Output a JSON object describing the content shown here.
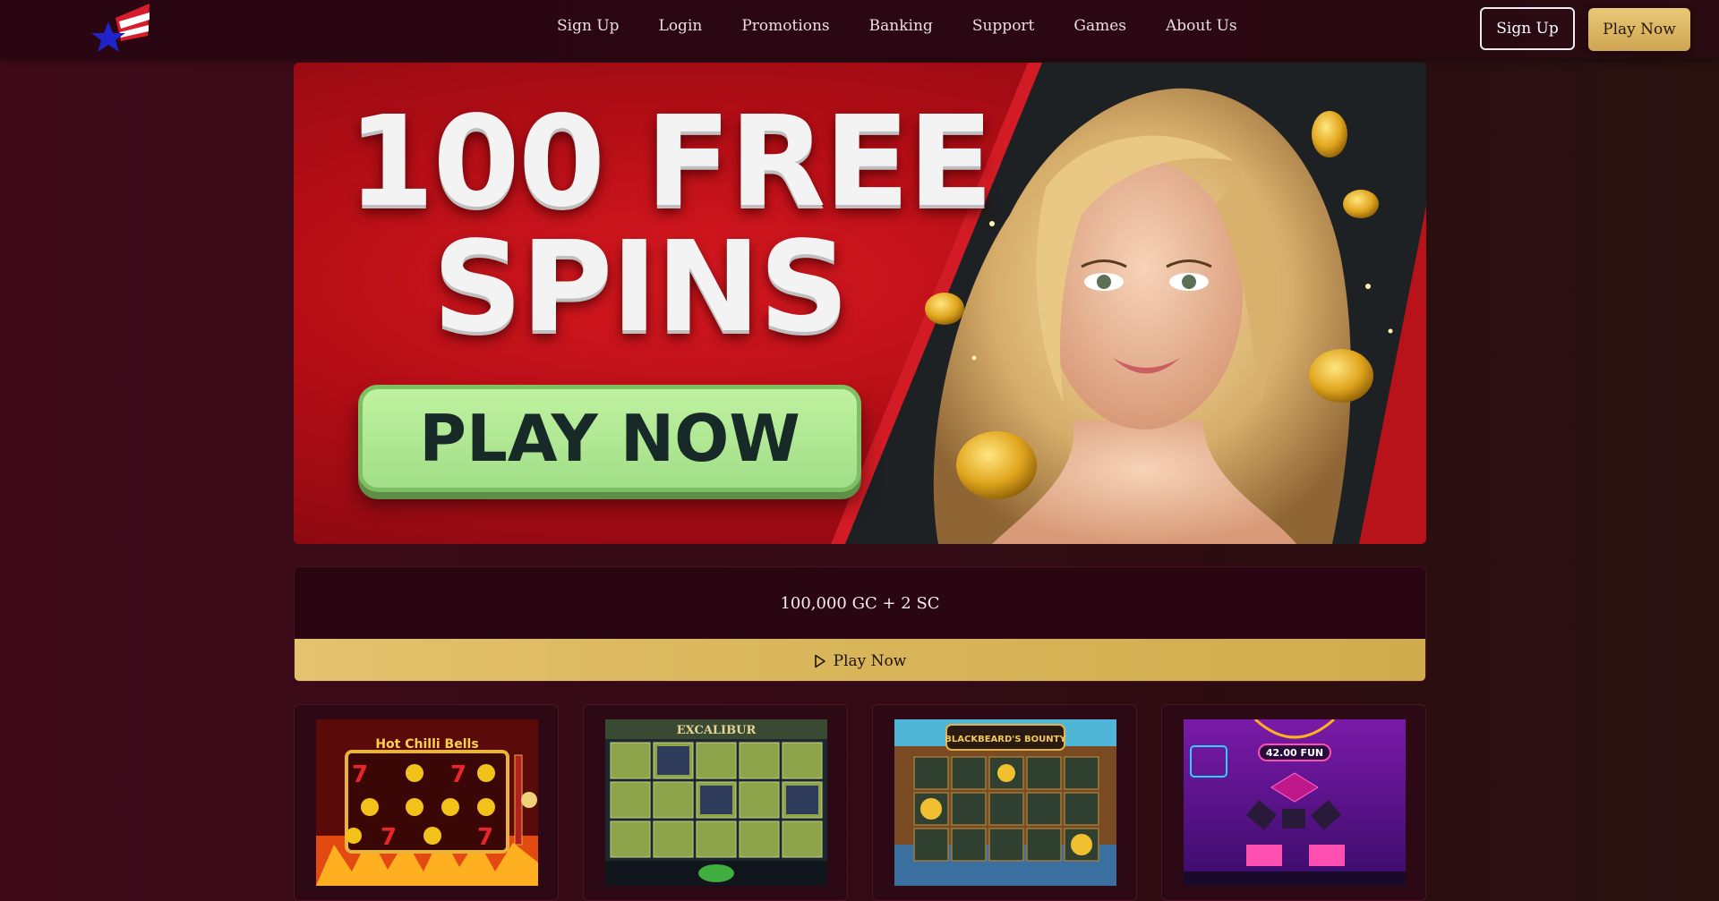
{
  "header": {
    "logo_icon": "star-flag-logo-icon",
    "nav": [
      "Sign Up",
      "Login",
      "Promotions",
      "Banking",
      "Support",
      "Games",
      "About Us"
    ],
    "signup_label": "Sign Up",
    "playnow_label": "Play Now"
  },
  "banner": {
    "line1": "100 FREE",
    "line2": "SPINS",
    "cta": "PLAY NOW"
  },
  "offer": {
    "text": "100,000 GC + 2 SC",
    "button_icon": "play-icon",
    "button_label": "Play Now"
  },
  "games": [
    {
      "thumb_text": "Hot Chilli Bells"
    },
    {
      "thumb_text": "EXCALIBUR"
    },
    {
      "thumb_text": "BLACKBEARD'S BOUNTY"
    },
    {
      "thumb_text": "42.00 FUN"
    }
  ],
  "colors": {
    "accent_gold": "#d8b559",
    "header_bg": "#2a0612",
    "banner_red": "#c4121b",
    "cta_green": "#a9e48f"
  }
}
